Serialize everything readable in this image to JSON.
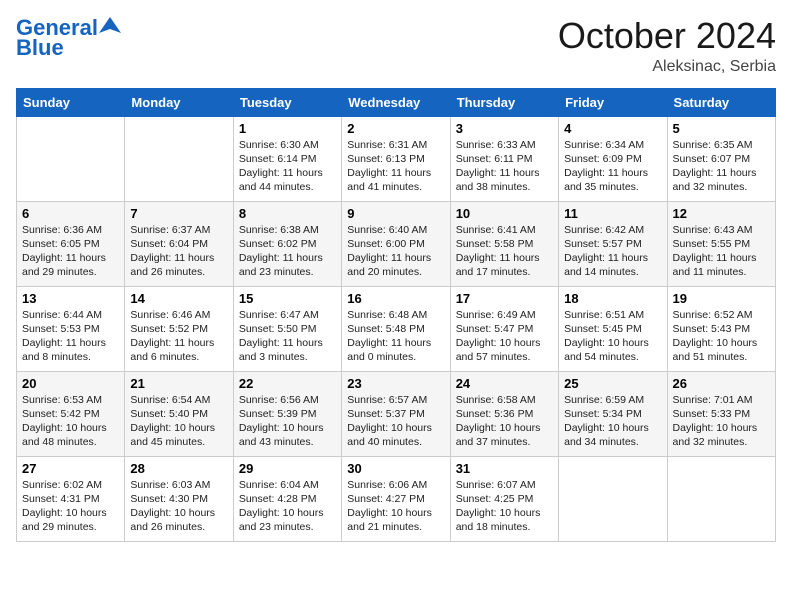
{
  "header": {
    "logo_line1": "General",
    "logo_line2": "Blue",
    "month_title": "October 2024",
    "location": "Aleksinac, Serbia"
  },
  "weekdays": [
    "Sunday",
    "Monday",
    "Tuesday",
    "Wednesday",
    "Thursday",
    "Friday",
    "Saturday"
  ],
  "weeks": [
    [
      {
        "day": "",
        "info": ""
      },
      {
        "day": "",
        "info": ""
      },
      {
        "day": "1",
        "info": "Sunrise: 6:30 AM\nSunset: 6:14 PM\nDaylight: 11 hours and 44 minutes."
      },
      {
        "day": "2",
        "info": "Sunrise: 6:31 AM\nSunset: 6:13 PM\nDaylight: 11 hours and 41 minutes."
      },
      {
        "day": "3",
        "info": "Sunrise: 6:33 AM\nSunset: 6:11 PM\nDaylight: 11 hours and 38 minutes."
      },
      {
        "day": "4",
        "info": "Sunrise: 6:34 AM\nSunset: 6:09 PM\nDaylight: 11 hours and 35 minutes."
      },
      {
        "day": "5",
        "info": "Sunrise: 6:35 AM\nSunset: 6:07 PM\nDaylight: 11 hours and 32 minutes."
      }
    ],
    [
      {
        "day": "6",
        "info": "Sunrise: 6:36 AM\nSunset: 6:05 PM\nDaylight: 11 hours and 29 minutes."
      },
      {
        "day": "7",
        "info": "Sunrise: 6:37 AM\nSunset: 6:04 PM\nDaylight: 11 hours and 26 minutes."
      },
      {
        "day": "8",
        "info": "Sunrise: 6:38 AM\nSunset: 6:02 PM\nDaylight: 11 hours and 23 minutes."
      },
      {
        "day": "9",
        "info": "Sunrise: 6:40 AM\nSunset: 6:00 PM\nDaylight: 11 hours and 20 minutes."
      },
      {
        "day": "10",
        "info": "Sunrise: 6:41 AM\nSunset: 5:58 PM\nDaylight: 11 hours and 17 minutes."
      },
      {
        "day": "11",
        "info": "Sunrise: 6:42 AM\nSunset: 5:57 PM\nDaylight: 11 hours and 14 minutes."
      },
      {
        "day": "12",
        "info": "Sunrise: 6:43 AM\nSunset: 5:55 PM\nDaylight: 11 hours and 11 minutes."
      }
    ],
    [
      {
        "day": "13",
        "info": "Sunrise: 6:44 AM\nSunset: 5:53 PM\nDaylight: 11 hours and 8 minutes."
      },
      {
        "day": "14",
        "info": "Sunrise: 6:46 AM\nSunset: 5:52 PM\nDaylight: 11 hours and 6 minutes."
      },
      {
        "day": "15",
        "info": "Sunrise: 6:47 AM\nSunset: 5:50 PM\nDaylight: 11 hours and 3 minutes."
      },
      {
        "day": "16",
        "info": "Sunrise: 6:48 AM\nSunset: 5:48 PM\nDaylight: 11 hours and 0 minutes."
      },
      {
        "day": "17",
        "info": "Sunrise: 6:49 AM\nSunset: 5:47 PM\nDaylight: 10 hours and 57 minutes."
      },
      {
        "day": "18",
        "info": "Sunrise: 6:51 AM\nSunset: 5:45 PM\nDaylight: 10 hours and 54 minutes."
      },
      {
        "day": "19",
        "info": "Sunrise: 6:52 AM\nSunset: 5:43 PM\nDaylight: 10 hours and 51 minutes."
      }
    ],
    [
      {
        "day": "20",
        "info": "Sunrise: 6:53 AM\nSunset: 5:42 PM\nDaylight: 10 hours and 48 minutes."
      },
      {
        "day": "21",
        "info": "Sunrise: 6:54 AM\nSunset: 5:40 PM\nDaylight: 10 hours and 45 minutes."
      },
      {
        "day": "22",
        "info": "Sunrise: 6:56 AM\nSunset: 5:39 PM\nDaylight: 10 hours and 43 minutes."
      },
      {
        "day": "23",
        "info": "Sunrise: 6:57 AM\nSunset: 5:37 PM\nDaylight: 10 hours and 40 minutes."
      },
      {
        "day": "24",
        "info": "Sunrise: 6:58 AM\nSunset: 5:36 PM\nDaylight: 10 hours and 37 minutes."
      },
      {
        "day": "25",
        "info": "Sunrise: 6:59 AM\nSunset: 5:34 PM\nDaylight: 10 hours and 34 minutes."
      },
      {
        "day": "26",
        "info": "Sunrise: 7:01 AM\nSunset: 5:33 PM\nDaylight: 10 hours and 32 minutes."
      }
    ],
    [
      {
        "day": "27",
        "info": "Sunrise: 6:02 AM\nSunset: 4:31 PM\nDaylight: 10 hours and 29 minutes."
      },
      {
        "day": "28",
        "info": "Sunrise: 6:03 AM\nSunset: 4:30 PM\nDaylight: 10 hours and 26 minutes."
      },
      {
        "day": "29",
        "info": "Sunrise: 6:04 AM\nSunset: 4:28 PM\nDaylight: 10 hours and 23 minutes."
      },
      {
        "day": "30",
        "info": "Sunrise: 6:06 AM\nSunset: 4:27 PM\nDaylight: 10 hours and 21 minutes."
      },
      {
        "day": "31",
        "info": "Sunrise: 6:07 AM\nSunset: 4:25 PM\nDaylight: 10 hours and 18 minutes."
      },
      {
        "day": "",
        "info": ""
      },
      {
        "day": "",
        "info": ""
      }
    ]
  ]
}
